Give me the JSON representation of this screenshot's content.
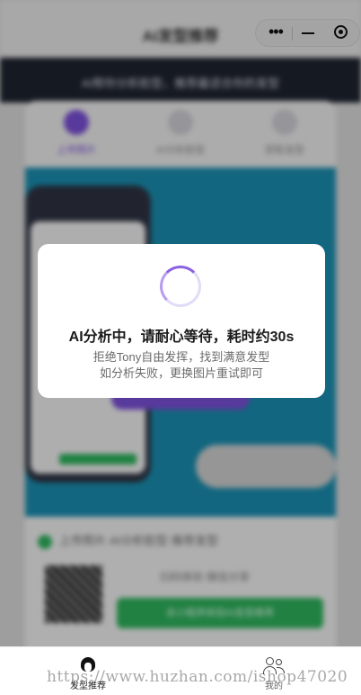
{
  "app": {
    "title": "AI发型推荐"
  },
  "banner": {
    "text": "AI帮你分析脸型，推荐最适合你的发型"
  },
  "tabs": [
    {
      "label": "上传照片"
    },
    {
      "label": "AI分析脸型"
    },
    {
      "label": "获取发型"
    }
  ],
  "bottom_card": {
    "line1": "上传照片·AI分析脸型·推荐发型",
    "line2": "扫码体验·微信分享",
    "button": "去小程序体验AI发型推荐"
  },
  "modal": {
    "title": "AI分析中，请耐心等待，耗时约30s",
    "line1": "拒绝Tony自由发挥，找到满意发型",
    "line2": "如分析失败，更换图片重试即可",
    "spinner_color": "#8b62e0"
  },
  "tabbar": {
    "items": [
      {
        "label": "发型推荐",
        "icon": "hairstyle-icon",
        "active": true
      },
      {
        "label": "我的",
        "icon": "user-icon",
        "active": false
      }
    ]
  },
  "watermark": {
    "text": "https://www.huzhan.com/ishop47020"
  },
  "colors": {
    "accent": "#7b4fd8",
    "green": "#2db35c"
  }
}
